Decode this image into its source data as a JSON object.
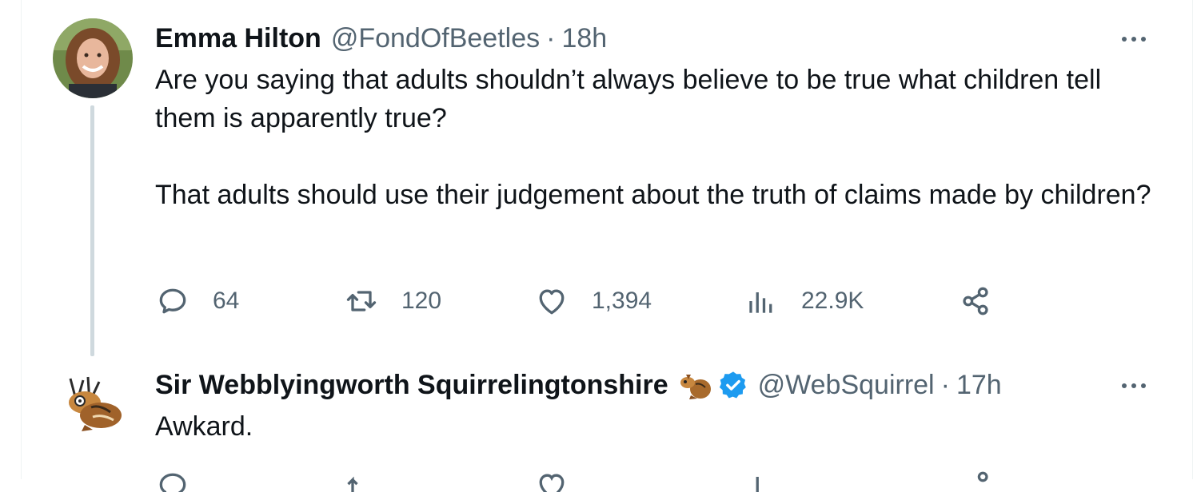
{
  "tweet1": {
    "name": "Emma Hilton",
    "handle": "@FondOfBeetles",
    "separator": "·",
    "time": "18h",
    "paragraphs": [
      "Are you saying that adults shouldn’t always believe to be true what children tell them is apparently true?",
      "That adults should use their judgement about the truth of claims made by children?"
    ],
    "stats": {
      "replies": "64",
      "retweets": "120",
      "likes": "1,394",
      "views": "22.9K"
    },
    "icons": [
      "reply-icon",
      "retweet-icon",
      "like-icon",
      "views-icon",
      "share-icon",
      "more-icon"
    ]
  },
  "tweet2": {
    "name": "Sir Webblyingworth Squirrelingtonshire",
    "handle": "@WebSquirrel",
    "separator": "·",
    "time": "17h",
    "text": "Awkard.",
    "icons": [
      "squirrel-emoji-icon",
      "verified-badge-icon",
      "more-icon"
    ]
  },
  "colors": {
    "text": "#0f1419",
    "secondary": "#536471",
    "verified": "#1d9bf0",
    "thread_line": "#cfd9de"
  }
}
